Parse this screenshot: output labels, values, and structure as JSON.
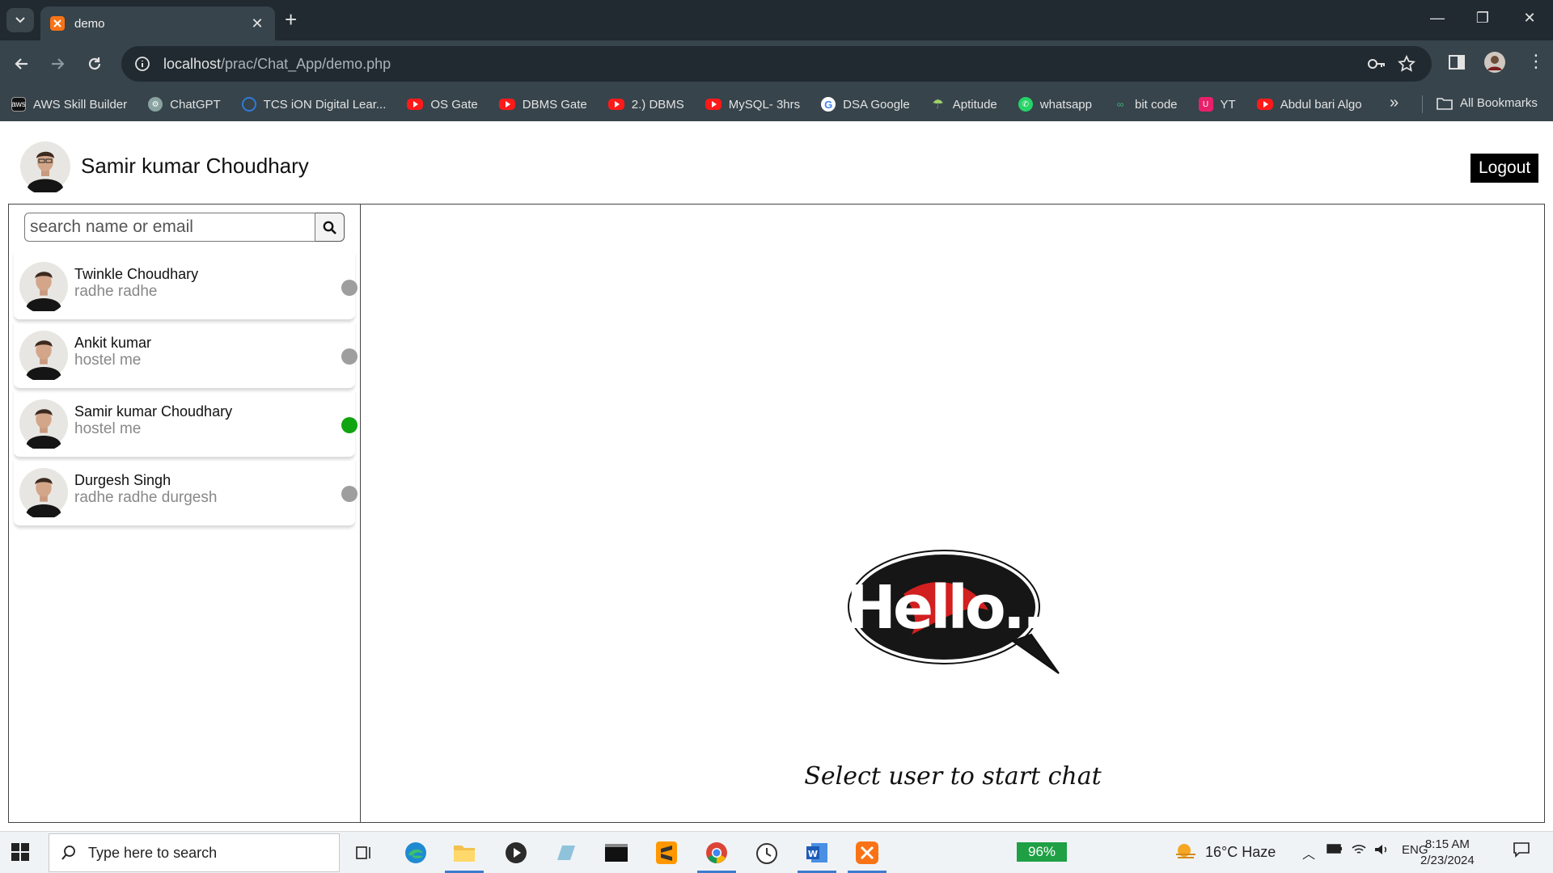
{
  "browser": {
    "tab_title": "demo",
    "url_host": "localhost",
    "url_path": "/prac/Chat_App/demo.php",
    "bookmarks": [
      {
        "label": "AWS Skill Builder",
        "icon": "aws-icon"
      },
      {
        "label": "ChatGPT",
        "icon": "chatgpt-icon"
      },
      {
        "label": "TCS iON Digital Lear...",
        "icon": "tcs-icon"
      },
      {
        "label": "OS Gate",
        "icon": "youtube-icon"
      },
      {
        "label": "DBMS Gate",
        "icon": "youtube-icon"
      },
      {
        "label": "2.) DBMS",
        "icon": "youtube-icon"
      },
      {
        "label": "MySQL- 3hrs",
        "icon": "youtube-icon"
      },
      {
        "label": "DSA Google",
        "icon": "google-icon"
      },
      {
        "label": "Aptitude",
        "icon": "aptitude-icon"
      },
      {
        "label": "whatsapp",
        "icon": "whatsapp-icon"
      },
      {
        "label": "bit code",
        "icon": "bitcode-icon"
      },
      {
        "label": "YT",
        "icon": "yt-icon"
      },
      {
        "label": "Abdul bari Algo",
        "icon": "youtube-icon"
      }
    ],
    "all_bookmarks": "All Bookmarks"
  },
  "app": {
    "current_user": "Samir kumar Choudhary",
    "logout_label": "Logout",
    "search_placeholder": "search name or email",
    "contacts": [
      {
        "name": "Twinkle Choudhary",
        "last_message": "radhe radhe",
        "status": "offline",
        "status_color": "#9e9e9e"
      },
      {
        "name": "Ankit kumar",
        "last_message": "hostel me",
        "status": "offline",
        "status_color": "#9e9e9e"
      },
      {
        "name": "Samir kumar Choudhary",
        "last_message": "hostel me",
        "status": "online",
        "status_color": "#11a411"
      },
      {
        "name": "Durgesh Singh",
        "last_message": "radhe radhe durgesh",
        "status": "offline",
        "status_color": "#9e9e9e"
      }
    ],
    "hello_text": "Hello..",
    "empty_state_message": "Select user to start chat"
  },
  "taskbar": {
    "search_placeholder": "Type here to search",
    "battery": "96%",
    "weather": "16°C  Haze",
    "language": "ENG",
    "time": "8:15 AM",
    "date": "2/23/2024"
  }
}
